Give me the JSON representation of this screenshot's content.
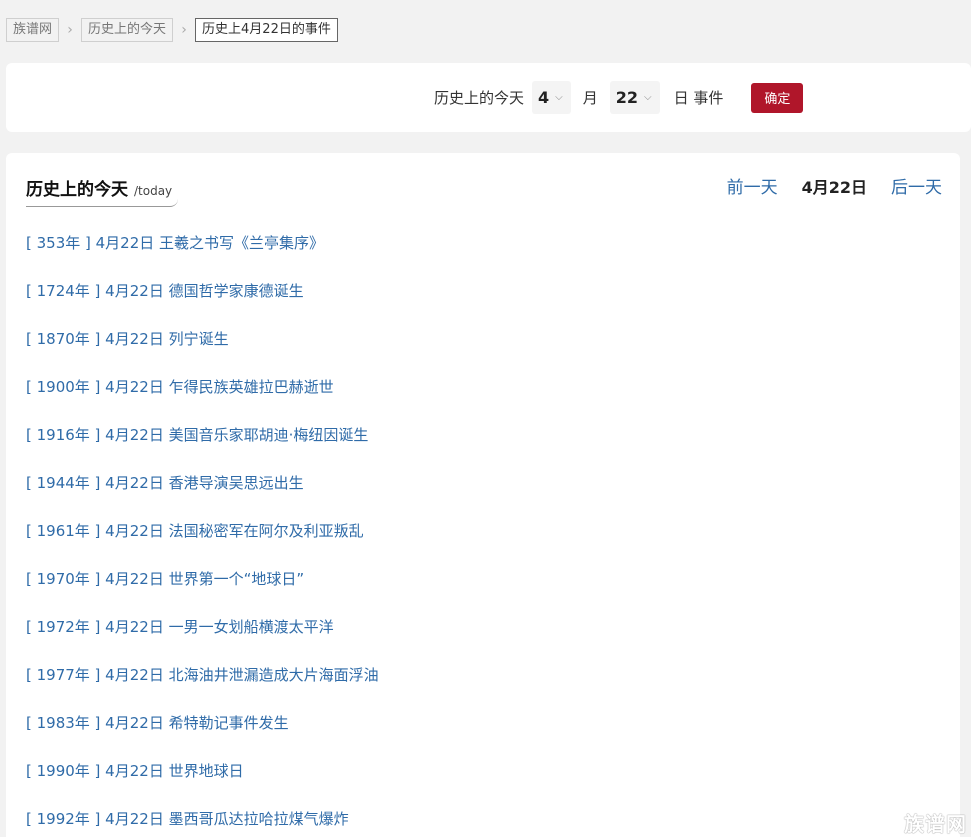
{
  "breadcrumb": {
    "home": "族谱网",
    "today": "历史上的今天",
    "current": "历史上4月22日的事件"
  },
  "filter": {
    "label": "历史上的今天",
    "month_value": "4",
    "month_unit": "月",
    "day_value": "22",
    "day_unit": "日 事件",
    "confirm_label": "确定"
  },
  "section": {
    "title": "历史上的今天",
    "subtitle": "/today",
    "prev_label": "前一天",
    "current_date": "4月22日",
    "next_label": "后一天"
  },
  "events": [
    "[ 353年 ] 4月22日 王羲之书写《兰亭集序》",
    "[ 1724年 ] 4月22日 德国哲学家康德诞生",
    "[ 1870年 ] 4月22日 列宁诞生",
    "[ 1900年 ] 4月22日 乍得民族英雄拉巴赫逝世",
    "[ 1916年 ] 4月22日 美国音乐家耶胡迪·梅纽因诞生",
    "[ 1944年 ] 4月22日 香港导演吴思远出生",
    "[ 1961年 ] 4月22日 法国秘密军在阿尔及利亚叛乱",
    "[ 1970年 ] 4月22日 世界第一个“地球日”",
    "[ 1972年 ] 4月22日 一男一女划船横渡太平洋",
    "[ 1977年 ] 4月22日 北海油井泄漏造成大片海面浮油",
    "[ 1983年 ] 4月22日 希特勒记事件发生",
    "[ 1990年 ] 4月22日 世界地球日",
    "[ 1992年 ] 4月22日 墨西哥瓜达拉哈拉煤气爆炸"
  ],
  "watermark": "族谱网",
  "colors": {
    "link": "#2f6ba8",
    "accent": "#b0162a",
    "background": "#f2f2f2"
  }
}
